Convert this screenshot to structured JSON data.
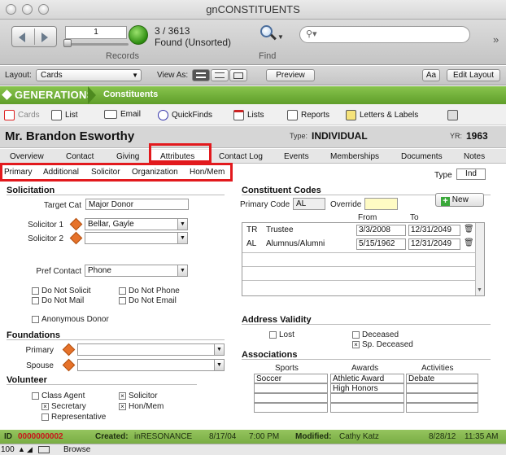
{
  "window": {
    "title": "gnCONSTITUENTS"
  },
  "toolbar": {
    "record_number": "1",
    "record_count": "3 / 3613",
    "found_state": "Found (Unsorted)",
    "records_label": "Records",
    "find_label": "Find",
    "search_placeholder": ""
  },
  "layoutbar": {
    "layout_label": "Layout:",
    "layout_value": "Cards",
    "view_as_label": "View As:",
    "preview_label": "Preview",
    "font_button_label": "Aa",
    "edit_layout_label": "Edit Layout"
  },
  "brand": {
    "logo": "GENERATIONS",
    "section": "Constituents",
    "green": "#6aa832"
  },
  "nav": {
    "items": [
      {
        "label": "Cards",
        "icon": "cards-icon"
      },
      {
        "label": "List",
        "icon": "list-icon"
      },
      {
        "label": "Email",
        "icon": "email-icon"
      },
      {
        "label": "QuickFinds",
        "icon": "magnifier-icon"
      },
      {
        "label": "Lists",
        "icon": "lists-icon"
      },
      {
        "label": "Reports",
        "icon": "reports-icon"
      },
      {
        "label": "Letters & Labels",
        "icon": "letters-icon"
      },
      {
        "label": "",
        "icon": "gift-icon"
      }
    ]
  },
  "record": {
    "name": "Mr. Brandon Esworthy",
    "type_label": "Type:",
    "type_value": "INDIVIDUAL",
    "yr_label": "YR:",
    "yr_value": "1963"
  },
  "tabs": [
    "Overview",
    "Contact",
    "Giving",
    "Attributes",
    "Contact Log",
    "Events",
    "Memberships",
    "Documents",
    "Notes"
  ],
  "subtabs": [
    "Primary",
    "Additional",
    "Solicitor",
    "Organization",
    "Hon/Mem"
  ],
  "type_toggle": {
    "label": "Type",
    "value": "Ind"
  },
  "solicitation": {
    "title": "Solicitation",
    "target_cat_label": "Target Cat",
    "target_cat_value": "Major Donor",
    "solicitor1_label": "Solicitor 1",
    "solicitor1_value": "Bellar, Gayle",
    "solicitor2_label": "Solicitor 2",
    "solicitor2_value": "",
    "pref_contact_label": "Pref Contact",
    "pref_contact_value": "Phone",
    "checks": [
      {
        "label": "Do Not Solicit",
        "checked": false
      },
      {
        "label": "Do Not Phone",
        "checked": false
      },
      {
        "label": "Do Not Mail",
        "checked": false
      },
      {
        "label": "Do Not Email",
        "checked": false
      },
      {
        "label": "Anonymous Donor",
        "checked": false
      }
    ]
  },
  "foundations": {
    "title": "Foundations",
    "primary_label": "Primary",
    "primary_value": "",
    "spouse_label": "Spouse",
    "spouse_value": ""
  },
  "volunteer": {
    "title": "Volunteer",
    "checks": [
      {
        "label": "Class Agent",
        "checked": false
      },
      {
        "label": "Solicitor",
        "checked": true
      },
      {
        "label": "Secretary",
        "checked": true
      },
      {
        "label": "Hon/Mem",
        "checked": true
      },
      {
        "label": "Representative",
        "checked": false
      }
    ]
  },
  "codes": {
    "title": "Constituent Codes",
    "primary_code_label": "Primary Code",
    "primary_code_value": "AL",
    "override_label": "Override",
    "override_value": "",
    "new_label": "New",
    "from_label": "From",
    "to_label": "To",
    "rows": [
      {
        "code": "TR",
        "desc": "Trustee",
        "from": "3/3/2008",
        "to": "12/31/2049"
      },
      {
        "code": "AL",
        "desc": "Alumnus/Alumni",
        "from": "5/15/1962",
        "to": "12/31/2049"
      }
    ]
  },
  "address_validity": {
    "title": "Address Validity",
    "checks": [
      {
        "label": "Lost",
        "checked": false
      },
      {
        "label": "Deceased",
        "checked": false
      },
      {
        "label": "Sp. Deceased",
        "checked": true
      }
    ]
  },
  "associations": {
    "title": "Associations",
    "headers": [
      "Sports",
      "Awards",
      "Activities"
    ],
    "sports": [
      "Soccer",
      "",
      "",
      ""
    ],
    "awards": [
      "Athletic Award",
      "High Honors",
      "",
      ""
    ],
    "activities": [
      "Debate",
      "",
      "",
      ""
    ]
  },
  "footer": {
    "id_label": "ID",
    "id_value": "0000000002",
    "created_label": "Created:",
    "created_by": "inRESONANCE",
    "created_date": "8/17/04",
    "created_time": "7:00 PM",
    "modified_label": "Modified:",
    "modified_by": "Cathy Katz",
    "modified_date": "8/28/12",
    "modified_time": "11:35 AM"
  },
  "status": {
    "zoom": "100",
    "mode": "Browse"
  },
  "highlight_color": "#e2191d"
}
